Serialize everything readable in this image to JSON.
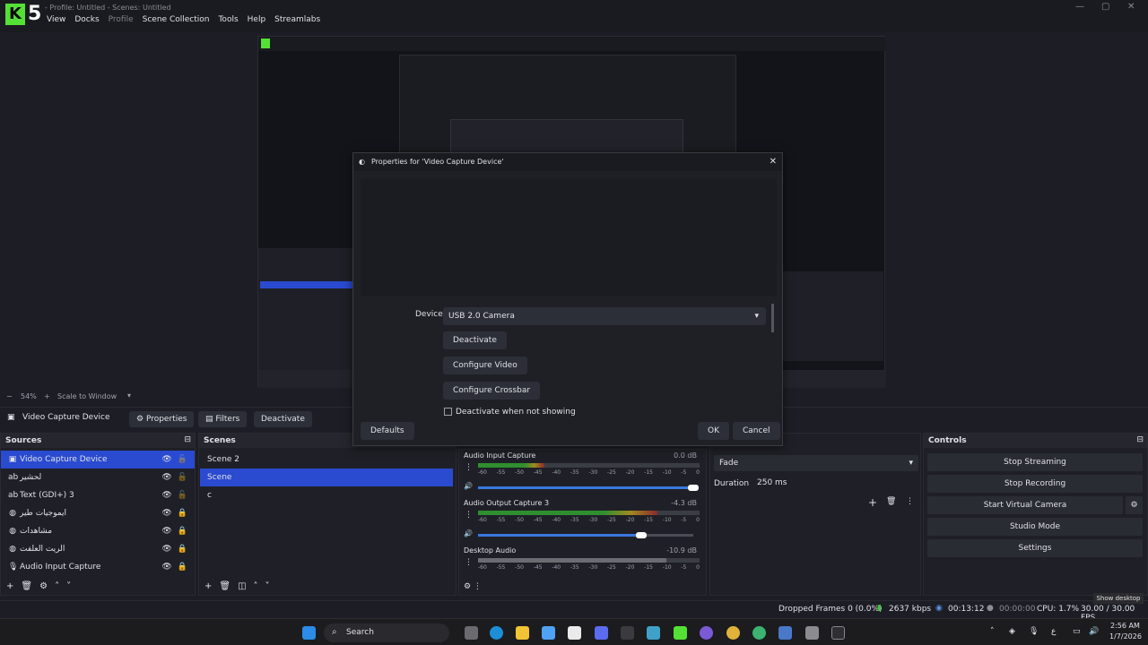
{
  "app": {
    "logo_letter": "K",
    "logo_number": "5",
    "title": "- Profile: Untitled - Scenes: Untitled",
    "menu": [
      "View",
      "Docks",
      "Profile",
      "Scene Collection",
      "Tools",
      "Help",
      "Streamlabs"
    ]
  },
  "zoom": {
    "percent": "54%",
    "mode": "Scale to Window"
  },
  "source_toolbar": {
    "selected_source": "Video Capture Device",
    "properties": "Properties",
    "filters": "Filters",
    "deactivate": "Deactivate"
  },
  "sources": {
    "title": "Sources",
    "items": [
      {
        "name": "Video Capture Device",
        "icon": "camera-icon",
        "selected": true,
        "locked": false
      },
      {
        "name": "لحشير",
        "icon": "text-icon",
        "selected": false,
        "locked": false
      },
      {
        "name": "Text (GDI+) 3",
        "icon": "text-icon",
        "selected": false,
        "locked": false
      },
      {
        "name": "ايموجيات طير",
        "icon": "browser-icon",
        "selected": false,
        "locked": true
      },
      {
        "name": "مشاهدات",
        "icon": "browser-icon",
        "selected": false,
        "locked": true
      },
      {
        "name": "الريت العلفت",
        "icon": "browser-icon",
        "selected": false,
        "locked": true
      },
      {
        "name": "Audio Input Capture",
        "icon": "mic-icon",
        "selected": false,
        "locked": true
      }
    ]
  },
  "scenes": {
    "title": "Scenes",
    "items": [
      "Scene 2",
      "Scene",
      "c"
    ],
    "selected_index": 1
  },
  "mixer": {
    "channels": [
      {
        "name": "Audio Input Capture",
        "db": "0.0 dB",
        "level": 0.3,
        "volume": 1.0
      },
      {
        "name": "Audio Output Capture 3",
        "db": "-4.3 dB",
        "level": 0.81,
        "volume": 0.76
      },
      {
        "name": "Desktop Audio",
        "db": "-10.9 dB",
        "level": 0.85,
        "volume": null
      }
    ],
    "ticks": [
      "-60",
      "-55",
      "-50",
      "-45",
      "-40",
      "-35",
      "-30",
      "-25",
      "-20",
      "-15",
      "-10",
      "-5",
      "0"
    ]
  },
  "transitions": {
    "type": "Fade",
    "duration_label": "Duration",
    "duration": "250 ms"
  },
  "controls": {
    "title": "Controls",
    "buttons": [
      "Stop Streaming",
      "Stop Recording",
      "Start Virtual Camera",
      "Studio Mode",
      "Settings"
    ]
  },
  "status": {
    "dropped": "Dropped Frames 0 (0.0%)",
    "bitrate": "2637 kbps",
    "stream_time": "00:13:12",
    "rec_time": "00:00:00",
    "cpu": "CPU: 1.7%",
    "fps": "30.00 / 30.00 FPS"
  },
  "dialog": {
    "title": "Properties for 'Video Capture Device'",
    "device_label": "Device",
    "device_value": "USB 2.0 Camera",
    "deactivate": "Deactivate",
    "configure_video": "Configure Video",
    "configure_crossbar": "Configure Crossbar",
    "checkbox_label": "Deactivate when not showing",
    "defaults": "Defaults",
    "ok": "OK",
    "cancel": "Cancel"
  },
  "taskbar": {
    "search": "Search",
    "time": "2:56 AM",
    "date": "1/7/2026",
    "show_desktop": "Show desktop"
  }
}
